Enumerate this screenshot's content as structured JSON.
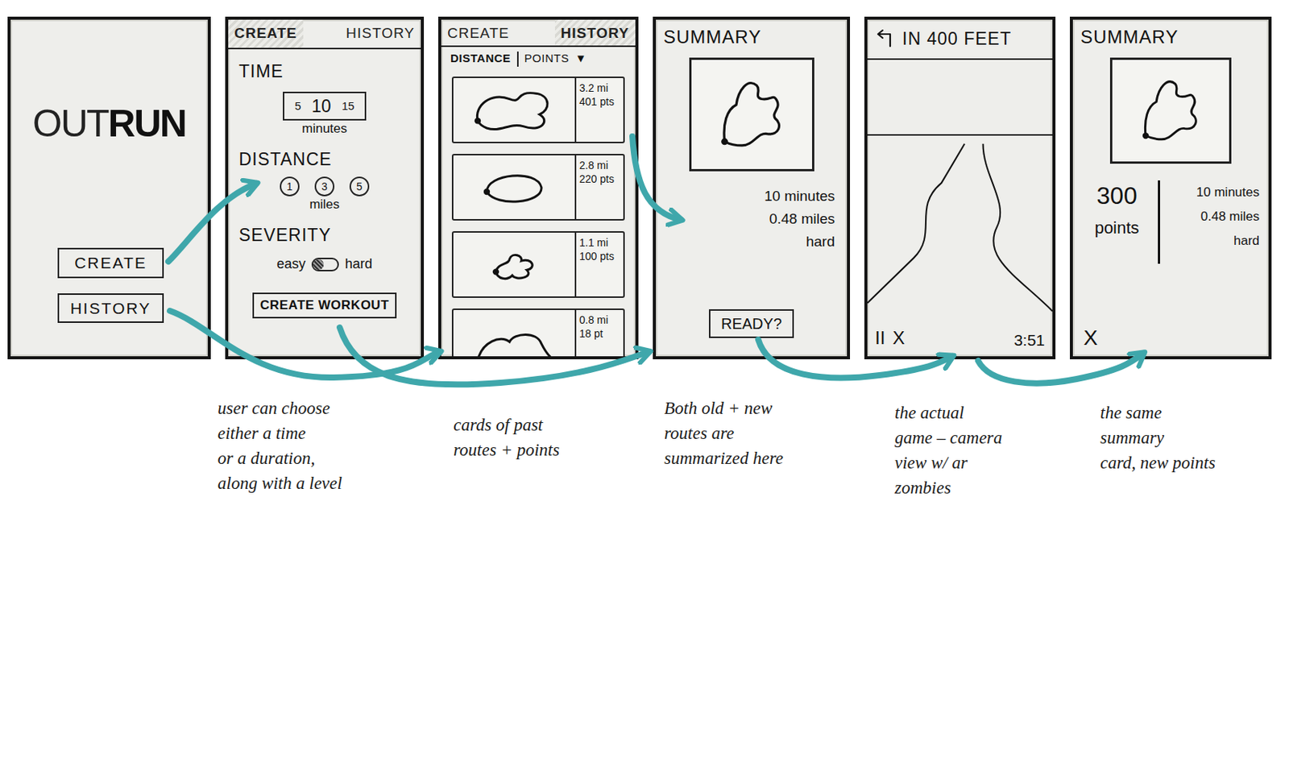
{
  "screens": [
    {
      "kind": "splash",
      "logo_light": "OUT",
      "logo_bold": "RUN",
      "buttons": [
        "CREATE",
        "HISTORY"
      ],
      "note": []
    },
    {
      "kind": "create",
      "tabs": [
        {
          "label": "CREATE",
          "selected": true
        },
        {
          "label": "HISTORY",
          "selected": false
        }
      ],
      "time": {
        "label": "TIME",
        "options": [
          {
            "label": "5",
            "selected": false
          },
          {
            "label": "10",
            "selected": true
          },
          {
            "label": "15",
            "selected": false
          }
        ],
        "unit": "minutes"
      },
      "distance": {
        "label": "DISTANCE",
        "options": [
          "1",
          "3",
          "5"
        ],
        "unit": "miles"
      },
      "severity": {
        "label": "SEVERITY",
        "low": "easy",
        "high": "hard",
        "on": false
      },
      "button": "CREATE WORKOUT",
      "note": [
        "user can choose",
        "either a time",
        "or a duration,",
        "along with a level"
      ]
    },
    {
      "kind": "history",
      "tabs": [
        {
          "label": "CREATE",
          "selected": false
        },
        {
          "label": "HISTORY",
          "selected": true
        }
      ],
      "sort": [
        {
          "label": "DISTANCE",
          "selected": true
        },
        {
          "label": "POINTS",
          "selected": false
        }
      ],
      "sort_icon": "▼",
      "cards": [
        {
          "distance": "3.2 mi",
          "points": "401 pts"
        },
        {
          "distance": "2.8 mi",
          "points": "220 pts"
        },
        {
          "distance": "1.1 mi",
          "points": "100 pts"
        },
        {
          "distance": "0.8 mi",
          "points": "18 pt"
        }
      ],
      "note": [
        "cards of past",
        "routes + points"
      ]
    },
    {
      "kind": "summary",
      "title": "SUMMARY",
      "stats": [
        "10 minutes",
        "0.48 miles",
        "hard"
      ],
      "button": "READY?",
      "note": [
        "Both old + new",
        "routes are",
        "summarized here"
      ]
    },
    {
      "kind": "game",
      "direction": "IN 400 FEET",
      "controls": [
        "II",
        "X"
      ],
      "timer": "3:51",
      "note": [
        "the actual",
        "game – camera",
        "view w/ ar",
        "zombies"
      ]
    },
    {
      "kind": "result",
      "title": "SUMMARY",
      "points": "300",
      "points_label": "points",
      "stats": [
        "10 minutes",
        "0.48 miles",
        "hard"
      ],
      "close": "X",
      "note": [
        "the same",
        "summary",
        "card, new points"
      ]
    }
  ]
}
